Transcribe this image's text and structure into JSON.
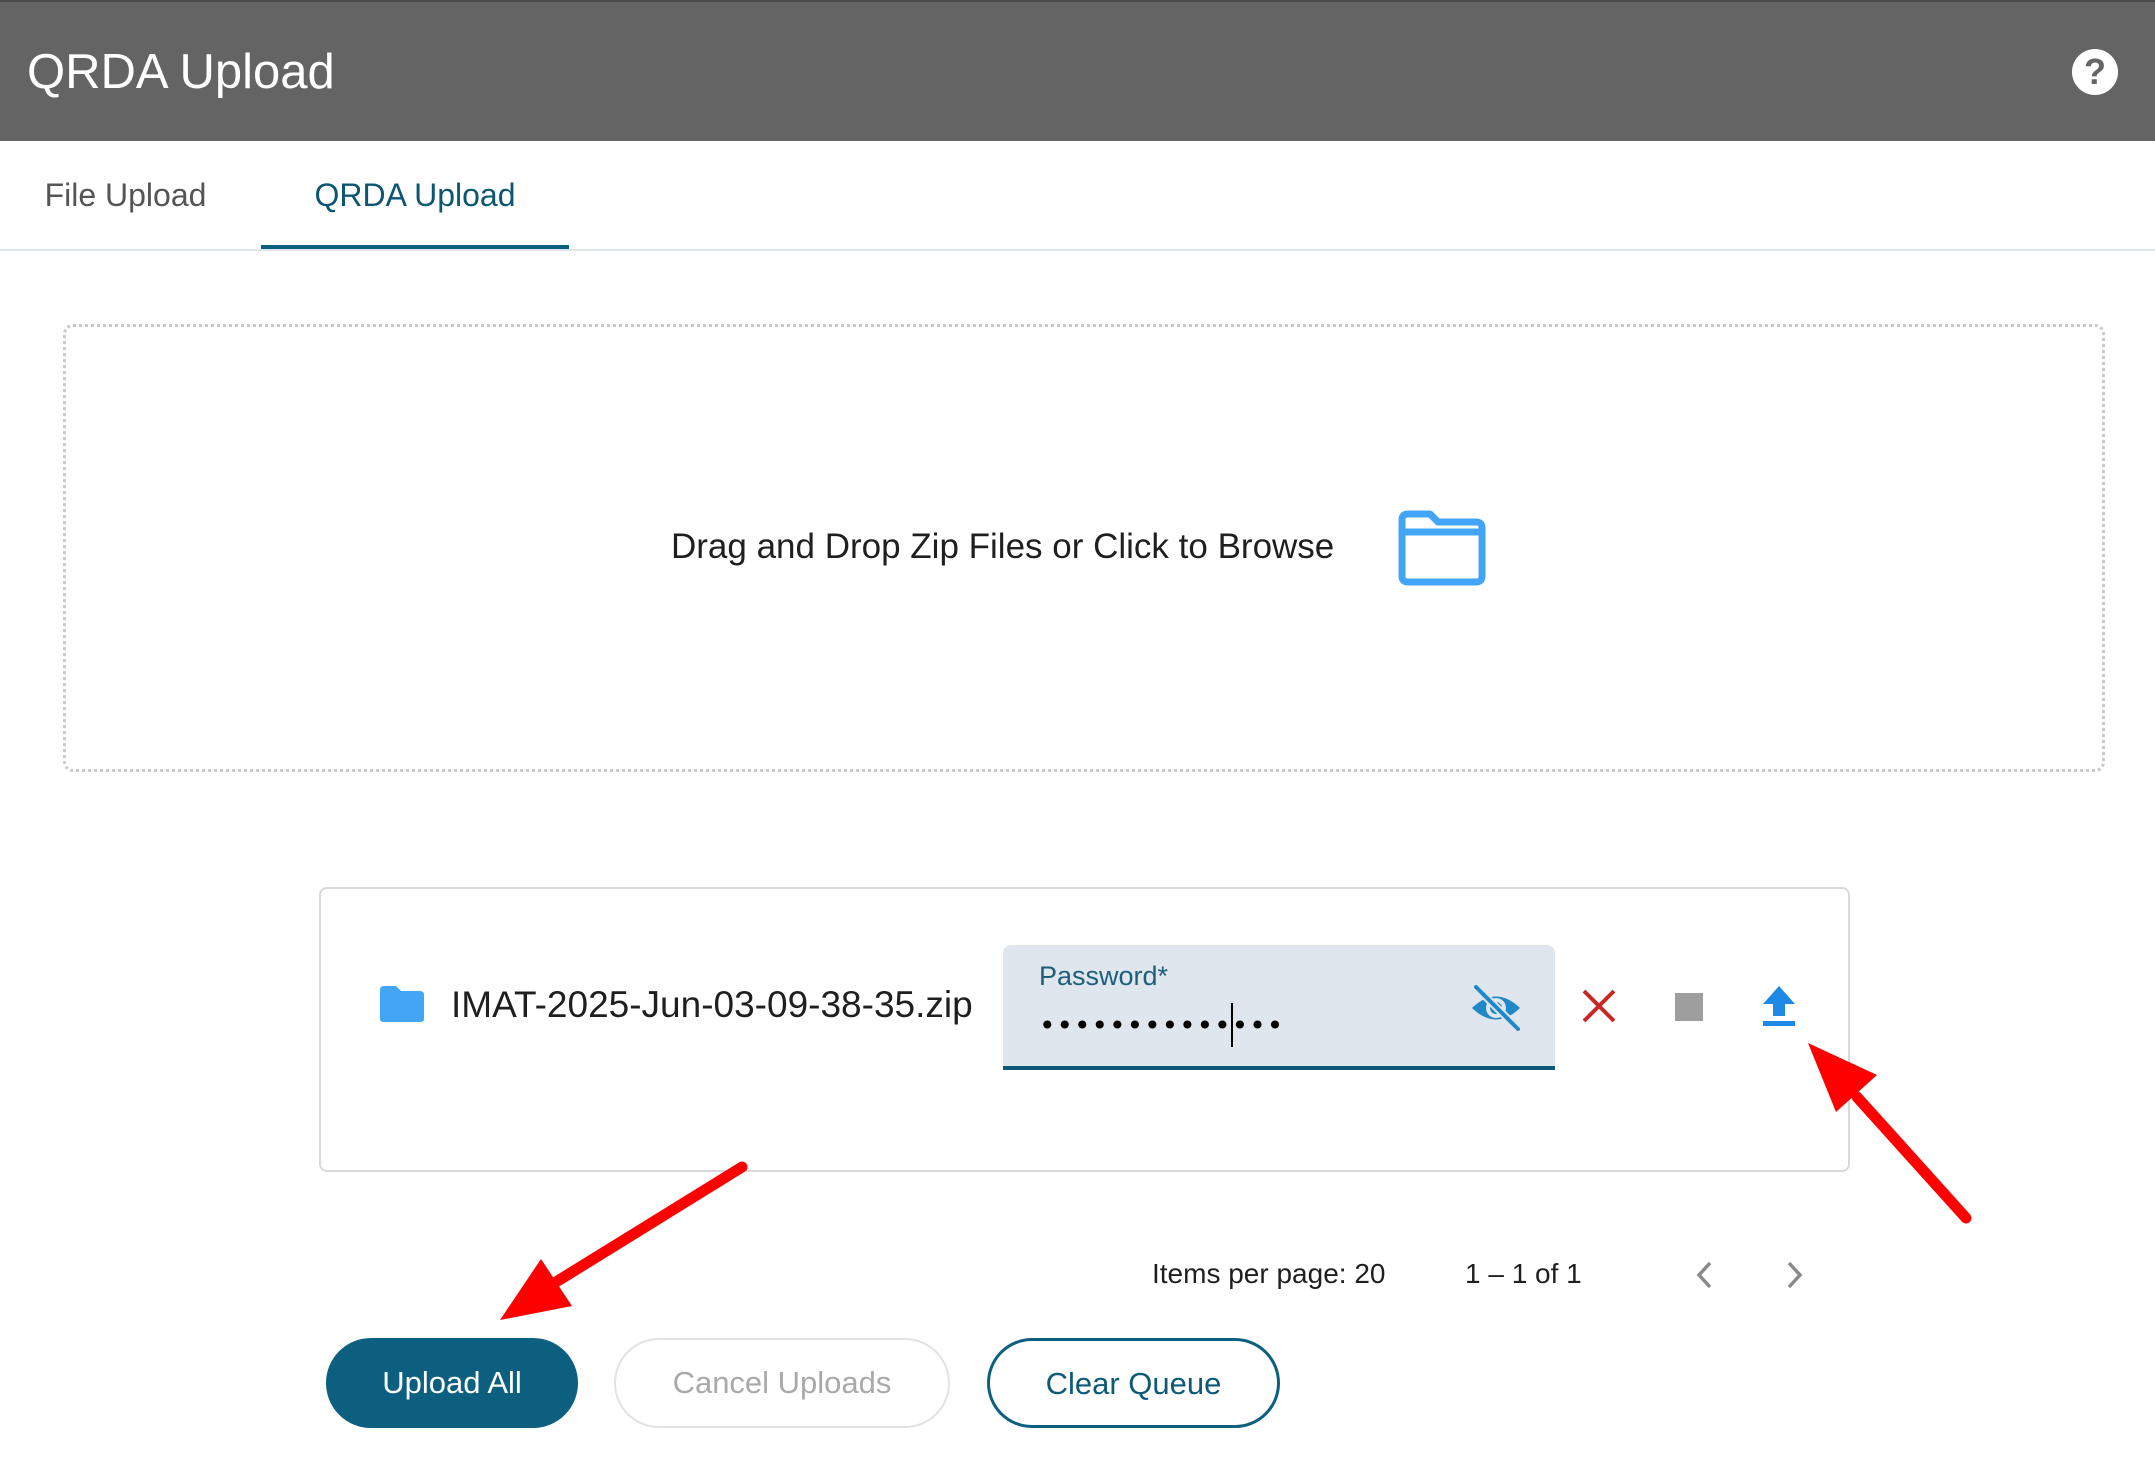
{
  "header": {
    "title": "QRDA Upload",
    "help_icon": "help-circle-icon"
  },
  "tabs": [
    {
      "label": "File Upload",
      "active": false
    },
    {
      "label": "QRDA Upload",
      "active": true
    }
  ],
  "dropzone": {
    "text": "Drag and Drop Zip Files or Click to Browse",
    "icon": "folder-outline-icon",
    "accent": "#42a5f5"
  },
  "queue": {
    "items": [
      {
        "file_icon": "folder-icon",
        "file_name": "IMAT-2025-Jun-03-09-38-35.zip",
        "password_label": "Password*",
        "password_value": "••••••••••••••",
        "visibility_icon": "eye-off-icon",
        "remove_icon": "close-icon",
        "stop_icon": "stop-icon",
        "upload_icon": "upload-icon"
      }
    ]
  },
  "pagination": {
    "items_per_page_label": "Items per page: 20",
    "range_label": "1 – 1 of 1",
    "prev_icon": "chevron-left-icon",
    "next_icon": "chevron-right-icon"
  },
  "actions": {
    "upload_all": "Upload All",
    "cancel_uploads": "Cancel Uploads",
    "clear_queue": "Clear Queue"
  },
  "colors": {
    "primary": "#0d5f7f",
    "header": "#646464",
    "danger": "#c62828",
    "folder": "#42a5f5",
    "annotation": "#ff0000"
  }
}
